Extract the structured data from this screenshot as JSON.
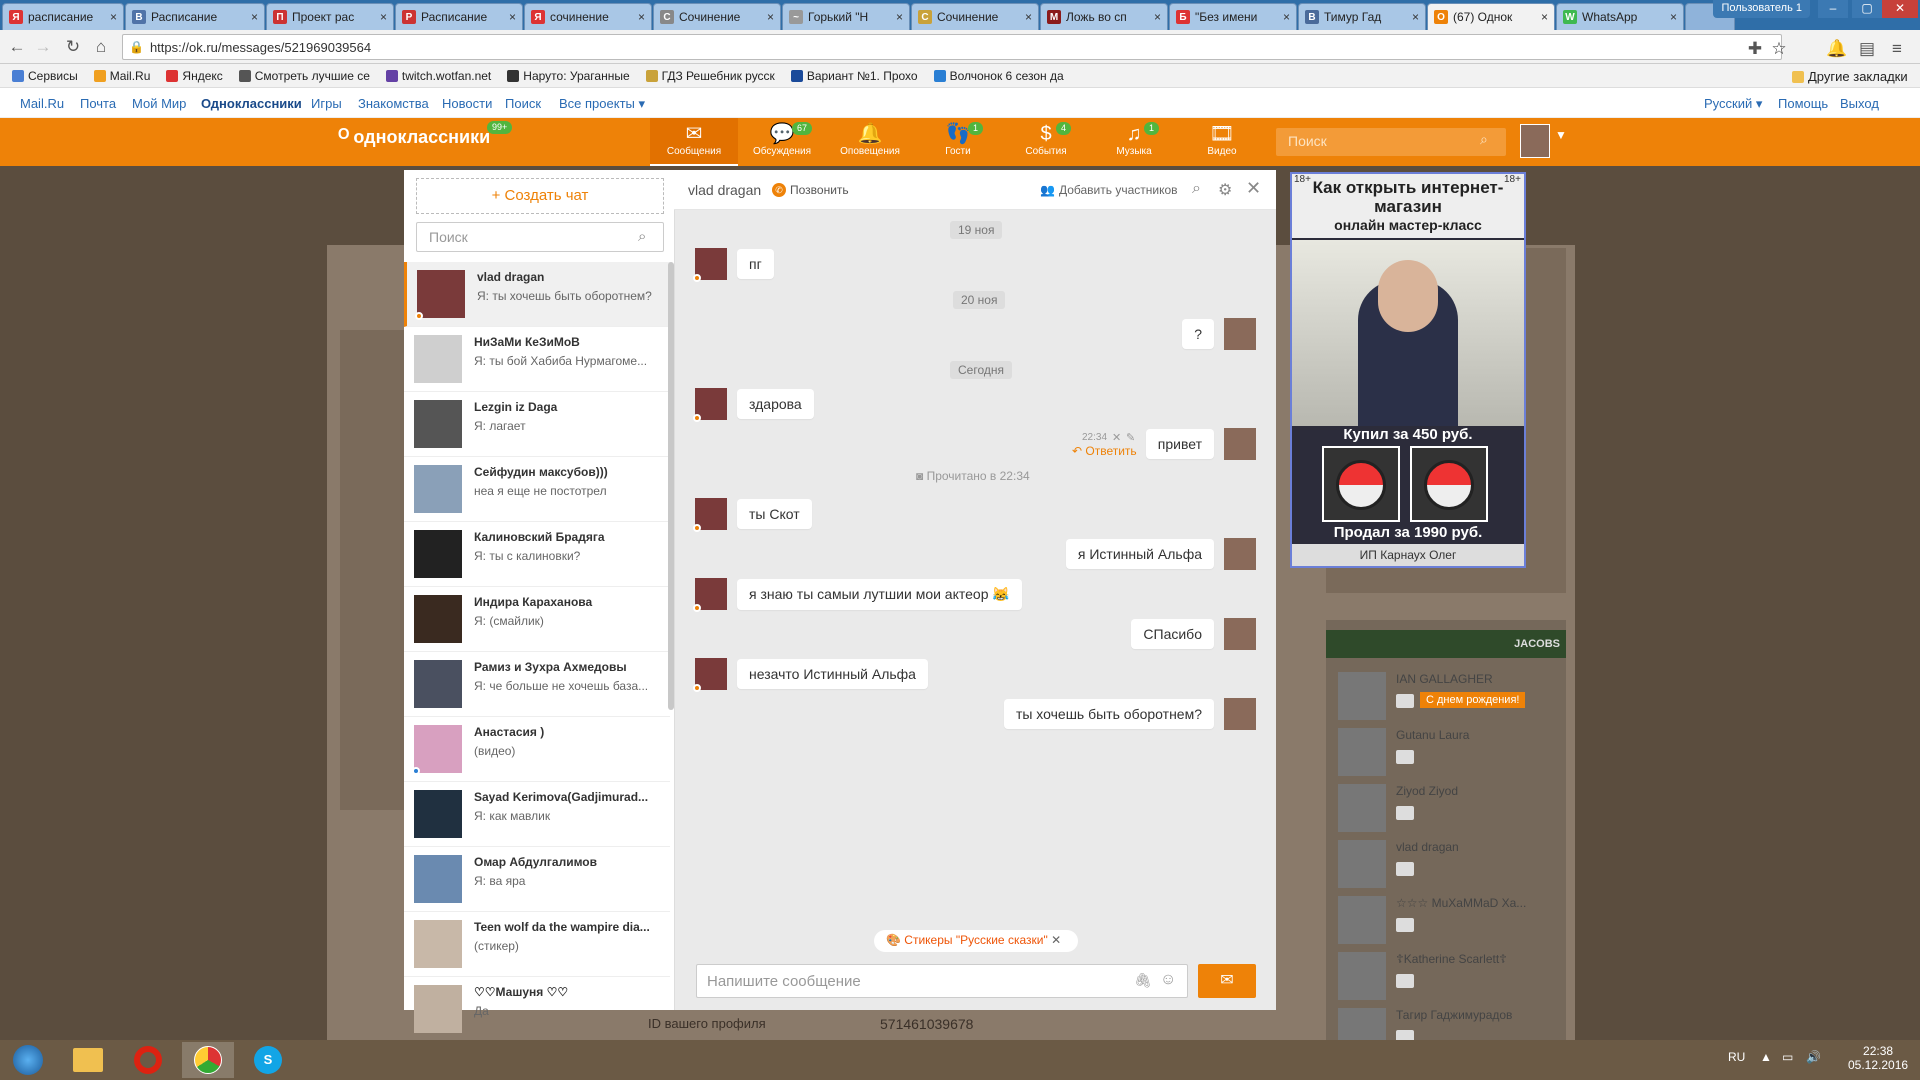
{
  "browser": {
    "tabs": [
      {
        "label": "расписание",
        "fav": "#d33",
        "fav_letter": "Я"
      },
      {
        "label": "Расписание",
        "fav": "#5073a8",
        "fav_letter": "В"
      },
      {
        "label": "Проект рас",
        "fav": "#c33",
        "fav_letter": "П"
      },
      {
        "label": "Расписание",
        "fav": "#c33",
        "fav_letter": "Р"
      },
      {
        "label": "сочинение",
        "fav": "#d33",
        "fav_letter": "Я"
      },
      {
        "label": "Сочинение",
        "fav": "#888",
        "fav_letter": "С"
      },
      {
        "label": "Горький \"Н",
        "fav": "#999",
        "fav_letter": "~"
      },
      {
        "label": "Сочинение",
        "fav": "#c9a23a",
        "fav_letter": "С"
      },
      {
        "label": "Ложь во сп",
        "fav": "#8b1a1a",
        "fav_letter": "M"
      },
      {
        "label": "\"Без имени",
        "fav": "#d33",
        "fav_letter": "Б"
      },
      {
        "label": "Тимур Гад",
        "fav": "#4a6a9a",
        "fav_letter": "В"
      },
      {
        "label": "(67) Однок",
        "fav": "#ee8208",
        "fav_letter": "О"
      },
      {
        "label": "WhatsApp",
        "fav": "#3fb950",
        "fav_letter": "W"
      }
    ],
    "user_label": "Пользователь 1",
    "url": "https://ok.ru/messages/521969039564",
    "bookmarks": [
      {
        "label": "Сервисы",
        "color": "#4a7fd4"
      },
      {
        "label": "Mail.Ru",
        "color": "#f0a020"
      },
      {
        "label": "Яндекс",
        "color": "#d33"
      },
      {
        "label": "Смотреть лучшие се",
        "color": "#555"
      },
      {
        "label": "twitch.wotfan.net",
        "color": "#6441a5"
      },
      {
        "label": "Наруто: Ураганные",
        "color": "#333"
      },
      {
        "label": "ГДЗ Решебник русск",
        "color": "#c9a23a"
      },
      {
        "label": "Вариант №1. Прохо",
        "color": "#1a4a9a"
      },
      {
        "label": "Волчонок 6 сезон да",
        "color": "#2a7fd4"
      }
    ],
    "other_bookmarks": "Другие закладки"
  },
  "mailbar": {
    "links": [
      "Mail.Ru",
      "Почта",
      "Мой Мир",
      "Одноклассники",
      "Игры",
      "Знакомства",
      "Новости",
      "Поиск",
      "Все проекты ▾"
    ],
    "right_links": [
      "Русский ▾",
      "Помощь",
      "Выход"
    ]
  },
  "ok": {
    "logo": "одноклассники",
    "logo_badge": "99+",
    "nav": [
      {
        "label": "Сообщения",
        "icon": "✉",
        "badge": ""
      },
      {
        "label": "Обсуждения",
        "icon": "💬",
        "badge": "67"
      },
      {
        "label": "Оповещения",
        "icon": "🔔",
        "badge": ""
      },
      {
        "label": "Гости",
        "icon": "👣",
        "badge": "1"
      },
      {
        "label": "События",
        "icon": "$",
        "badge": "4"
      },
      {
        "label": "Музыка",
        "icon": "♫",
        "badge": "1"
      },
      {
        "label": "Видео",
        "icon": "🎞",
        "badge": ""
      }
    ],
    "search_placeholder": "Поиск"
  },
  "chat_list": {
    "create": "+  Создать чат",
    "search_placeholder": "Поиск",
    "items": [
      {
        "name": "vlad dragan",
        "msg": "Я: ты хочешь быть оборотнем?",
        "color": "#7a3a3a",
        "online": "#ee8208"
      },
      {
        "name": "НиЗаМи КеЗиМоВ",
        "msg": "Я: ты бой Хабиба Нурмагоме...",
        "color": "#cfcfcf",
        "online": ""
      },
      {
        "name": "Lezgin iz Daga",
        "msg": "Я: лагает",
        "color": "#555",
        "online": ""
      },
      {
        "name": "Сейфудин максубов)))",
        "msg": "неа я еще  не постотрел",
        "color": "#8aa0b8",
        "online": ""
      },
      {
        "name": "Калиновский Брадяга",
        "msg": "Я: ты с калиновки?",
        "color": "#222",
        "online": ""
      },
      {
        "name": "Индира Караханова",
        "msg": "Я: (смайлик)",
        "color": "#3a2a20",
        "online": ""
      },
      {
        "name": "Рамиз и Зухра Ахмедовы",
        "msg": "Я: че больше не хочешь база...",
        "color": "#4a5060",
        "online": ""
      },
      {
        "name": "Анастасия )",
        "msg": "(видео)",
        "color": "#d8a0c0",
        "online": "#2a7fd4"
      },
      {
        "name": "Sayad Kerimova(Gadjimurad...",
        "msg": "Я: как мавлик",
        "color": "#203040",
        "online": ""
      },
      {
        "name": "Омар Абдулгалимов",
        "msg": "Я: ва яра",
        "color": "#6a8ab0",
        "online": ""
      },
      {
        "name": "Teen wolf da the wampire dia...",
        "msg": "(стикер)",
        "color": "#c8b8a8",
        "online": ""
      },
      {
        "name": "♡♡Машуня ♡♡",
        "msg": "Да",
        "color": "#c0b0a0",
        "online": ""
      }
    ]
  },
  "chat": {
    "title": "vlad dragan",
    "call": "Позвонить",
    "add_members": "Добавить участников",
    "dates": [
      "19 ноя",
      "20 ноя",
      "Сегодня"
    ],
    "messages": [
      {
        "side": "in",
        "text": "пг"
      },
      {
        "side": "out",
        "text": "?"
      },
      {
        "side": "in",
        "text": "здарова"
      },
      {
        "side": "out",
        "text": "привет"
      },
      {
        "side": "in",
        "text": "ты Скот"
      },
      {
        "side": "out",
        "text": "я Истинный Альфа"
      },
      {
        "side": "in",
        "text": "я знаю      ты самыи лутшии мои актеор 😹"
      },
      {
        "side": "out",
        "text": "СПасибо"
      },
      {
        "side": "in",
        "text": "незачто  Истинный Альфа"
      },
      {
        "side": "out",
        "text": "ты хочешь быть оборотнем?"
      }
    ],
    "time": "22:34",
    "reply": "Ответить",
    "read": "Прочитано в 22:34",
    "sticker_bar": "Стикеры \"Русские сказки\"",
    "input_placeholder": "Напишите сообщение"
  },
  "ad": {
    "age": "18+",
    "title": "Как открыть интернет-магазин",
    "subtitle": "онлайн мастер-класс",
    "bought": "Купил за 450 руб.",
    "sold": "Продал за 1990 руб.",
    "footer": "ИП Карнаух Олег"
  },
  "right_col": {
    "brand": "JACOBS",
    "friends": [
      {
        "name": "IAN GALLAGHER",
        "extra": "С днем рождения!"
      },
      {
        "name": "Gutanu Laura",
        "extra": ""
      },
      {
        "name": "Ziyod Ziyod",
        "extra": ""
      },
      {
        "name": "vlad dragan",
        "extra": ""
      },
      {
        "name": "☆☆☆ MuXaMMaD Xa...",
        "extra": ""
      },
      {
        "name": "☦Katherine Scarlett☦",
        "extra": ""
      },
      {
        "name": "Тагир Гаджимурадов",
        "extra": ""
      }
    ],
    "profile_id_label": "ID вашего профиля",
    "profile_id": "571461039678"
  },
  "taskbar": {
    "lang": "RU",
    "time": "22:38",
    "date": "05.12.2016"
  }
}
